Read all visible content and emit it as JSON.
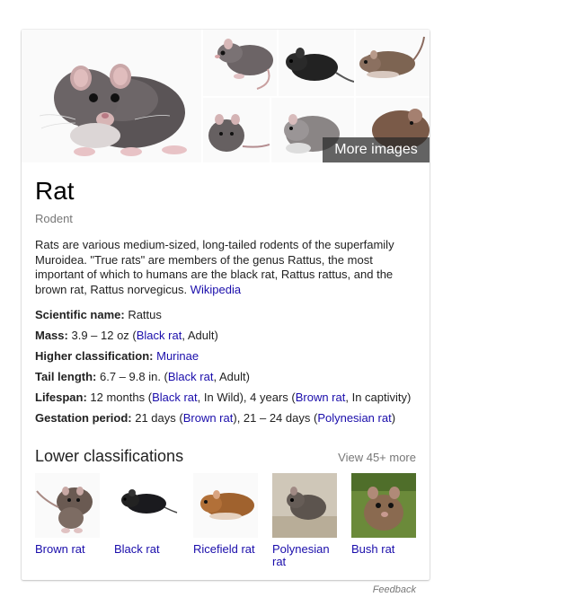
{
  "images": {
    "more_label": "More images"
  },
  "entity": {
    "title": "Rat",
    "subtitle": "Rodent",
    "description": "Rats are various medium-sized, long-tailed rodents of the superfamily Muroidea. \"True rats\" are members of the genus Rattus, the most important of which to humans are the black rat, Rattus rattus, and the brown rat, Rattus norvegicus.",
    "source_link": "Wikipedia"
  },
  "facts": [
    {
      "label": "Scientific name:",
      "parts": [
        {
          "t": " Rattus"
        }
      ]
    },
    {
      "label": "Mass:",
      "parts": [
        {
          "t": " 3.9 – 12 oz ("
        },
        {
          "t": "Black rat",
          "link": true
        },
        {
          "t": ", Adult)"
        }
      ]
    },
    {
      "label": "Higher classification:",
      "parts": [
        {
          "t": " "
        },
        {
          "t": "Murinae",
          "link": true
        }
      ]
    },
    {
      "label": "Tail length:",
      "parts": [
        {
          "t": " 6.7 – 9.8 in. ("
        },
        {
          "t": "Black rat",
          "link": true
        },
        {
          "t": ", Adult)"
        }
      ]
    },
    {
      "label": "Lifespan:",
      "parts": [
        {
          "t": " 12 months ("
        },
        {
          "t": "Black rat",
          "link": true
        },
        {
          "t": ", In Wild), 4 years ("
        },
        {
          "t": "Brown rat",
          "link": true
        },
        {
          "t": ", In captivity)"
        }
      ]
    },
    {
      "label": "Gestation period:",
      "parts": [
        {
          "t": " 21 days ("
        },
        {
          "t": "Brown rat",
          "link": true
        },
        {
          "t": "), 21 – 24 days ("
        },
        {
          "t": "Polynesian rat",
          "link": true
        },
        {
          "t": ")"
        }
      ]
    }
  ],
  "lower": {
    "heading": "Lower classifications",
    "view_more": "View 45+ more",
    "items": [
      {
        "label": "Brown rat"
      },
      {
        "label": "Black rat"
      },
      {
        "label": "Ricefield rat"
      },
      {
        "label": "Polynesian rat"
      },
      {
        "label": "Bush rat"
      }
    ]
  },
  "footer": {
    "feedback": "Feedback"
  }
}
